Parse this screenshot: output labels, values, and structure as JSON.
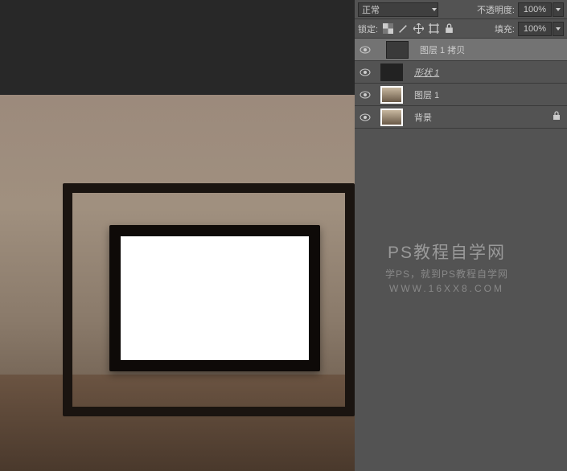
{
  "panel": {
    "blendMode": "正常",
    "opacityLabel": "不透明度:",
    "opacityValue": "100%",
    "lockLabel": "锁定:",
    "fillLabel": "填充:",
    "fillValue": "100%"
  },
  "layers": [
    {
      "name": "图层 1 拷贝",
      "italic": false,
      "selected": true,
      "locked": false,
      "indent": true
    },
    {
      "name": "形状 1",
      "italic": true,
      "selected": false,
      "locked": false,
      "indent": false
    },
    {
      "name": "图层 1",
      "italic": false,
      "selected": false,
      "locked": false,
      "indent": false
    },
    {
      "name": "背景",
      "italic": false,
      "selected": false,
      "locked": true,
      "indent": false
    }
  ],
  "watermark": {
    "line1": "PS教程自学网",
    "line2": "学PS，就到PS教程自学网",
    "line3": "WWW.16XX8.COM"
  }
}
